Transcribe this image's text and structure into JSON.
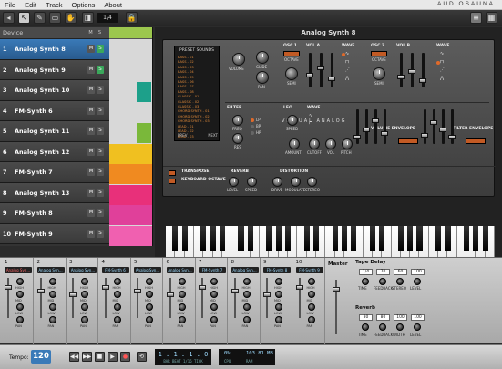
{
  "menubar": {
    "items": [
      "File",
      "Edit",
      "Track",
      "Options",
      "About"
    ],
    "brand": "AUDIOSAUNA"
  },
  "toolbar": {
    "zoom": "1/4"
  },
  "tracklist": {
    "header_label": "Device",
    "header_m": "M",
    "header_s": "S",
    "tracks": [
      {
        "num": "1",
        "name": "Analog Synth 8",
        "m": "M",
        "s": "S"
      },
      {
        "num": "2",
        "name": "Analog Synth 9",
        "m": "M",
        "s": "S"
      },
      {
        "num": "3",
        "name": "Analog Synth 10",
        "m": "M",
        "s": "S"
      },
      {
        "num": "4",
        "name": "FM-Synth 6",
        "m": "M",
        "s": "S"
      },
      {
        "num": "5",
        "name": "Analog Synth 11",
        "m": "M",
        "s": "S"
      },
      {
        "num": "6",
        "name": "Analog Synth 12",
        "m": "M",
        "s": "S"
      },
      {
        "num": "7",
        "name": "FM-Synth 7",
        "m": "M",
        "s": "S"
      },
      {
        "num": "8",
        "name": "Analog Synth 13",
        "m": "M",
        "s": "S"
      },
      {
        "num": "9",
        "name": "FM-Synth 8",
        "m": "M",
        "s": "S"
      },
      {
        "num": "10",
        "name": "FM-Synth 9",
        "m": "M",
        "s": "S"
      }
    ]
  },
  "colors": {
    "accent": "#3a7ab8",
    "orange": "#c25a24",
    "green": "#3aa85b"
  },
  "synth": {
    "title": "Analog Synth 8",
    "preset_title": "PRESET SOUNDS",
    "presets": [
      "BASS - 01",
      "BASS - 02",
      "BASS - 03",
      "BASS - 04",
      "BASS - 05",
      "BASS - 06",
      "BASS - 07",
      "BASS - 08",
      "CLASSIC - 01",
      "CLASSIC - 02",
      "CLASSIC - 03",
      "CHORD SYNTH - 01",
      "CHORD SYNTH - 02",
      "CHORD SYNTH - 03",
      "LEAD - 01",
      "LEAD - 02",
      "LEAD - 03",
      "LEAD - 04",
      "LEAD - 05"
    ],
    "prev": "PREV",
    "next": "NEXT",
    "virtual_analog": "VIRTUAL ANALOG",
    "labels": {
      "volume": "VOLUME",
      "glide": "GLIDE",
      "pan": "PAN",
      "osc1": "OSC 1",
      "osc2": "OSC 2",
      "octave": "OCTAVE",
      "semi": "SEMI",
      "vol_a": "VOL A",
      "vol_b": "VOL B",
      "wave": "WAVE",
      "filter": "FILTER",
      "freq": "FREQ",
      "res": "RES",
      "lp": "LP",
      "bp": "BP",
      "hp": "HP",
      "lfo": "LFO",
      "speed": "SPEED",
      "amount": "AMOUNT",
      "pitch": "PITCH",
      "cutoff": "CUTOFF",
      "vol": "VOL",
      "volume_envelope": "VOLUME ENVELOPE",
      "filter_envelope": "FILTER ENVELOPE",
      "adsr": [
        "A",
        "D",
        "S",
        "R"
      ],
      "transpose": "TRANSPOSE",
      "keyboard_octave": "KEYBOARD OCTAVE",
      "reverb": "REVERB",
      "level": "LEVEL",
      "distortion": "DISTORTION",
      "drive": "DRIVE",
      "modulate": "MODULATE",
      "stereo": "STEREO"
    }
  },
  "mixer": {
    "channels": [
      {
        "num": "1",
        "name": "Analog Syn..."
      },
      {
        "num": "2",
        "name": "Analog Syn..."
      },
      {
        "num": "3",
        "name": "Analog Syn..."
      },
      {
        "num": "4",
        "name": "FM-Synth 6"
      },
      {
        "num": "5",
        "name": "Analog Syn..."
      },
      {
        "num": "6",
        "name": "Analog Syn..."
      },
      {
        "num": "7",
        "name": "FM-Synth 7"
      },
      {
        "num": "8",
        "name": "Analog Syn..."
      },
      {
        "num": "9",
        "name": "FM-Synth 8"
      },
      {
        "num": "10",
        "name": "FM-Synth 9"
      }
    ],
    "knob_labels": [
      "HIGH",
      "MID",
      "LOW",
      "PAN"
    ],
    "master_label": "Master",
    "tape_delay": {
      "title": "Tape Delay",
      "values": [
        "1/4",
        "70",
        "60",
        "100"
      ],
      "labels": [
        "TIME",
        "FEEDBACK",
        "STEREO",
        "LEVEL"
      ]
    },
    "reverb": {
      "title": "Reverb",
      "values": [
        "80",
        "80",
        "100",
        "100"
      ],
      "labels": [
        "TIME",
        "FEEDBACK",
        "WIDTH",
        "LEVEL"
      ]
    }
  },
  "transport": {
    "tempo_label": "Tempo:",
    "tempo": "120",
    "position": "1 . 1 . 1 . 0",
    "position_labels": "BAR   BEAT  1/16  TICK",
    "cpu": "0%",
    "memory": "103.81 MB",
    "cpu_label": "CPU",
    "mem_label": "RAM"
  }
}
